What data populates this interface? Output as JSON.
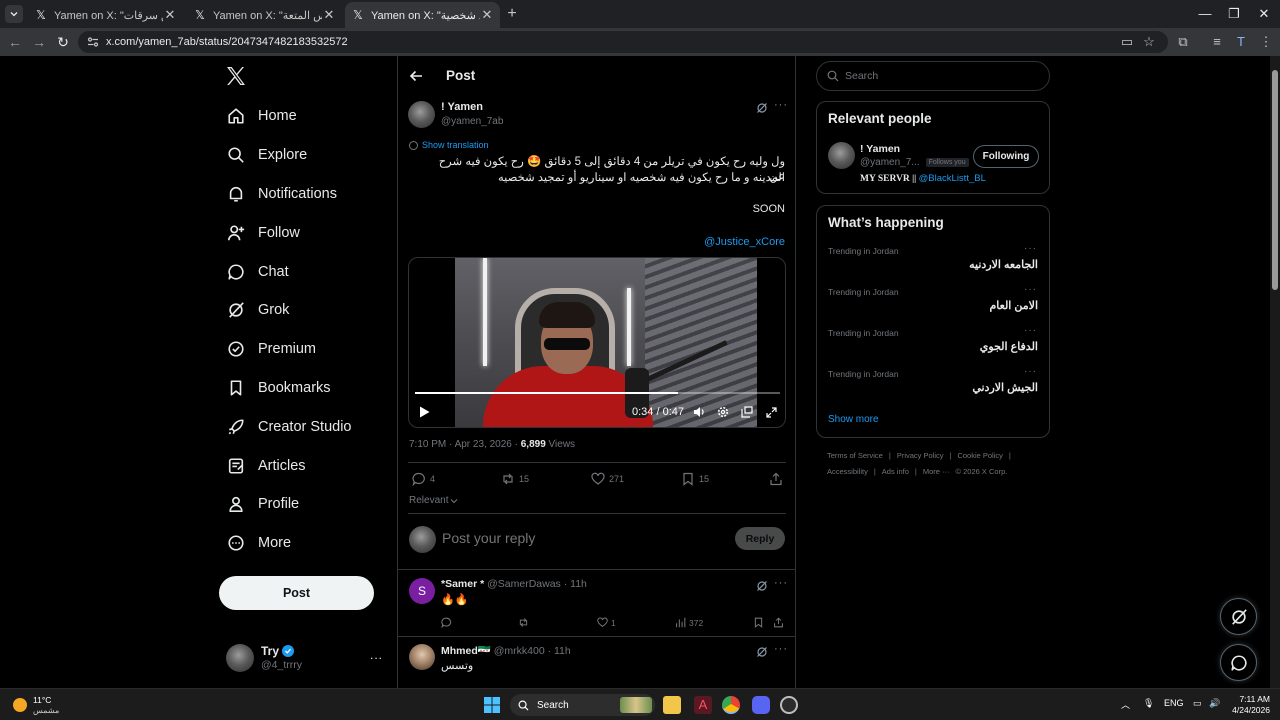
{
  "browser": {
    "tabs": [
      {
        "title": "Yamen on X: \"رح ترهق سرقات\" / X !"
      },
      {
        "title": "Yamen on X: \"يعني ونس المتعة\" / X !"
      },
      {
        "title": "Yamen on X: \"أو تمجيد شخصية\" / X !"
      }
    ],
    "url": "x.com/yamen_7ab/status/2047347482183532572"
  },
  "nav": {
    "items": [
      {
        "label": "Home"
      },
      {
        "label": "Explore"
      },
      {
        "label": "Notifications"
      },
      {
        "label": "Follow"
      },
      {
        "label": "Chat"
      },
      {
        "label": "Grok"
      },
      {
        "label": "Premium"
      },
      {
        "label": "Bookmarks"
      },
      {
        "label": "Creator Studio"
      },
      {
        "label": "Articles"
      },
      {
        "label": "Profile"
      },
      {
        "label": "More"
      }
    ],
    "post_button": "Post",
    "account": {
      "name": "Try",
      "handle": "@4_trrry",
      "more": "..."
    }
  },
  "main": {
    "title": "Post",
    "tweet": {
      "name": "! Yamen",
      "handle": "@yamen_7ab",
      "show_translation": "Show translation",
      "text_line1": "ول وليه رح يكون في تريلر من 4 دقائق إلى 5 دقائق 🤩 رح يكون فيه شرح عن",
      "text_line2": "المدينه و ما رح يكون فيه شخصيه او سيناريو أو تمجيد شخصيه",
      "soon": "SOON",
      "mention": "@Justice_xCore",
      "video": {
        "time": "0:34 / 0:47",
        "progress": 0.72
      },
      "meta_time": "7:10 PM · Apr 23, 2026 · ",
      "views_count": "6,899",
      "views_label": " Views",
      "replies": "4",
      "reposts": "15",
      "likes": "271",
      "bookmarks": "15",
      "sort_label": "Relevant"
    },
    "reply_box": {
      "placeholder": "Post your reply",
      "button": "Reply"
    },
    "comments": [
      {
        "avatar_letter": "S",
        "name": "*Samer *",
        "handle": " @SamerDawas · 11h",
        "text": "🔥🔥",
        "replies": "",
        "reposts": "",
        "likes": "1",
        "views": "372"
      },
      {
        "name": "Mhmed🇸🇾",
        "handle": " @mrkk400 · 11h",
        "text": "وتسس"
      }
    ]
  },
  "right": {
    "search_placeholder": "Search",
    "relevant_people": {
      "title": "Relevant people",
      "name": "! Yamen",
      "handle": "@yamen_7...",
      "follows_you": "Follows you",
      "button": "Following",
      "bio_text": "MY SERVR || ",
      "bio_link": "@BlackListt_BL"
    },
    "whats_happening": {
      "title": "What’s happening",
      "trends": [
        {
          "context": "Trending in Jordan",
          "name": "الجامعه الاردنيه"
        },
        {
          "context": "Trending in Jordan",
          "name": "الامن العام"
        },
        {
          "context": "Trending in Jordan",
          "name": "الدفاع الجوي"
        },
        {
          "context": "Trending in Jordan",
          "name": "الجيش الاردني"
        }
      ],
      "show_more": "Show more"
    },
    "footer": {
      "line1": [
        "Terms of Service",
        "|",
        "Privacy Policy",
        "|",
        "Cookie Policy",
        "|"
      ],
      "line2": [
        "Accessibility",
        "|",
        "Ads info",
        "|",
        "More ···",
        "© 2026 X Corp."
      ]
    }
  },
  "taskbar": {
    "temp": "11°C",
    "condition": "مشمس",
    "search": "Search",
    "lang": "ENG",
    "time": "7:11 AM",
    "date": "4/24/2026"
  }
}
